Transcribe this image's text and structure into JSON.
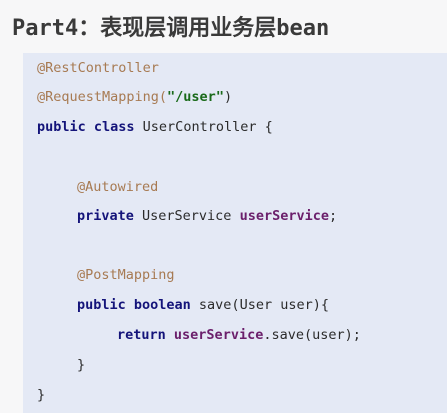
{
  "title": "Part4：表现层调用业务层bean",
  "code": {
    "l1_ann": "@RestController",
    "l2_ann": "@RequestMapping(",
    "l2_str": "\"/user\"",
    "l2_close": ")",
    "l3_kw": "public class",
    "l3_rest": " UserController {",
    "l4_ann": "@Autowired",
    "l5_kw": "private",
    "l5_type": " UserService ",
    "l5_field": "userService",
    "l5_semi": ";",
    "l6_ann": "@PostMapping",
    "l7_kw": "public boolean",
    "l7_rest": " save(User user){",
    "l8_kw": "return",
    "l8_sp": " ",
    "l8_field": "userService",
    "l8_rest": ".save(user);",
    "l9_close": "}",
    "l10_close": "}"
  }
}
